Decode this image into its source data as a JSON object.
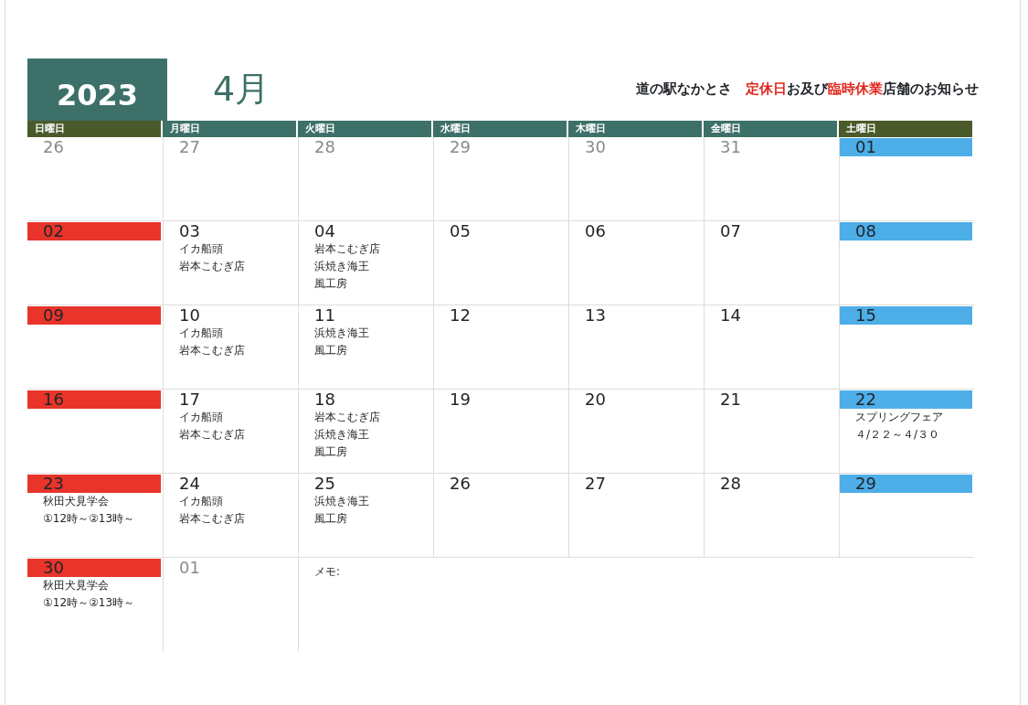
{
  "year": "2023",
  "month": "4月",
  "title_parts": [
    {
      "text": "道の駅なかとさ　",
      "highlight": false
    },
    {
      "text": "定休日",
      "highlight": true
    },
    {
      "text": "お及び",
      "highlight": false
    },
    {
      "text": "臨時休業",
      "highlight": true
    },
    {
      "text": "店舗のお知らせ",
      "highlight": false
    }
  ],
  "weekdays": [
    {
      "label": "日曜日",
      "kind": "weekend"
    },
    {
      "label": "月曜日",
      "kind": "weekday"
    },
    {
      "label": "火曜日",
      "kind": "weekday"
    },
    {
      "label": "水曜日",
      "kind": "weekday"
    },
    {
      "label": "木曜日",
      "kind": "weekday"
    },
    {
      "label": "金曜日",
      "kind": "weekday"
    },
    {
      "label": "土曜日",
      "kind": "weekend"
    }
  ],
  "weeks": [
    {
      "days": [
        {
          "day": "26",
          "kind": "other"
        },
        {
          "day": "27",
          "kind": "other"
        },
        {
          "day": "28",
          "kind": "other"
        },
        {
          "day": "29",
          "kind": "other"
        },
        {
          "day": "30",
          "kind": "other"
        },
        {
          "day": "31",
          "kind": "other"
        },
        {
          "day": "01",
          "kind": "saturday"
        }
      ]
    },
    {
      "days": [
        {
          "day": "02",
          "kind": "sunday"
        },
        {
          "day": "03",
          "kind": "weekday",
          "events": [
            "イカ船頭",
            "岩本こむぎ店"
          ]
        },
        {
          "day": "04",
          "kind": "weekday",
          "events": [
            "岩本こむぎ店",
            "浜焼き海王",
            "風工房"
          ]
        },
        {
          "day": "05",
          "kind": "weekday"
        },
        {
          "day": "06",
          "kind": "weekday"
        },
        {
          "day": "07",
          "kind": "weekday"
        },
        {
          "day": "08",
          "kind": "saturday"
        }
      ]
    },
    {
      "days": [
        {
          "day": "09",
          "kind": "sunday"
        },
        {
          "day": "10",
          "kind": "weekday",
          "events": [
            "イカ船頭",
            "岩本こむぎ店"
          ]
        },
        {
          "day": "11",
          "kind": "weekday",
          "events": [
            "浜焼き海王",
            "風工房"
          ]
        },
        {
          "day": "12",
          "kind": "weekday"
        },
        {
          "day": "13",
          "kind": "weekday"
        },
        {
          "day": "14",
          "kind": "weekday"
        },
        {
          "day": "15",
          "kind": "saturday"
        }
      ]
    },
    {
      "days": [
        {
          "day": "16",
          "kind": "sunday"
        },
        {
          "day": "17",
          "kind": "weekday",
          "events": [
            "イカ船頭",
            "岩本こむぎ店"
          ]
        },
        {
          "day": "18",
          "kind": "weekday",
          "events": [
            "岩本こむぎ店",
            "浜焼き海王",
            "風工房"
          ]
        },
        {
          "day": "19",
          "kind": "weekday"
        },
        {
          "day": "20",
          "kind": "weekday"
        },
        {
          "day": "21",
          "kind": "weekday"
        },
        {
          "day": "22",
          "kind": "saturday",
          "events": [
            "スプリングフェア",
            "４/２２～４/３０"
          ]
        }
      ]
    },
    {
      "days": [
        {
          "day": "23",
          "kind": "sunday",
          "events": [
            "秋田犬見学会",
            "①12時～②13時～"
          ]
        },
        {
          "day": "24",
          "kind": "weekday",
          "events": [
            "イカ船頭",
            "岩本こむぎ店"
          ]
        },
        {
          "day": "25",
          "kind": "weekday",
          "events": [
            "浜焼き海王",
            "風工房"
          ]
        },
        {
          "day": "26",
          "kind": "weekday"
        },
        {
          "day": "27",
          "kind": "weekday"
        },
        {
          "day": "28",
          "kind": "weekday"
        },
        {
          "day": "29",
          "kind": "saturday"
        }
      ]
    },
    {
      "days": [
        {
          "day": "30",
          "kind": "sunday",
          "events": [
            "秋田犬見学会",
            "①12時～②13時～"
          ]
        },
        {
          "day": "01",
          "kind": "other"
        }
      ],
      "memo": "メモ:"
    }
  ]
}
